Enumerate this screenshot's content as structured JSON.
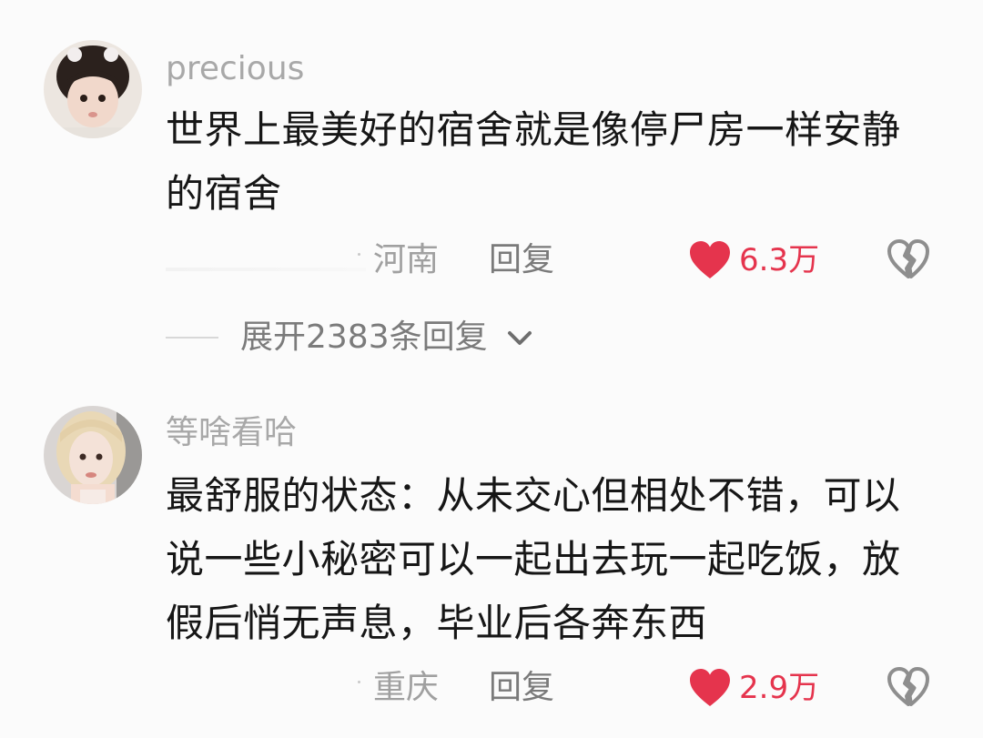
{
  "comments": [
    {
      "username": "precious",
      "text": "世界上最美好的宿舍就是像停尸房一样安静的宿舍",
      "location": "河南",
      "reply_label": "回复",
      "like_count": "6.3万",
      "liked": true,
      "expand_replies_label": "展开2383条回复"
    },
    {
      "username": "等啥看哈",
      "text": "最舒服的状态：从未交心但相处不错，可以说一些小秘密可以一起出去玩一起吃饭，放假后悄无声息，毕业后各奔东西",
      "location": "重庆",
      "reply_label": "回复",
      "like_count": "2.9万",
      "liked": true
    }
  ],
  "icons": {
    "like": "heart-filled-icon",
    "dislike": "broken-heart-icon",
    "expand": "chevron-down-icon"
  },
  "colors": {
    "like_red": "#e5344d",
    "muted_text": "#a8a8a8",
    "body_text": "#161616"
  }
}
